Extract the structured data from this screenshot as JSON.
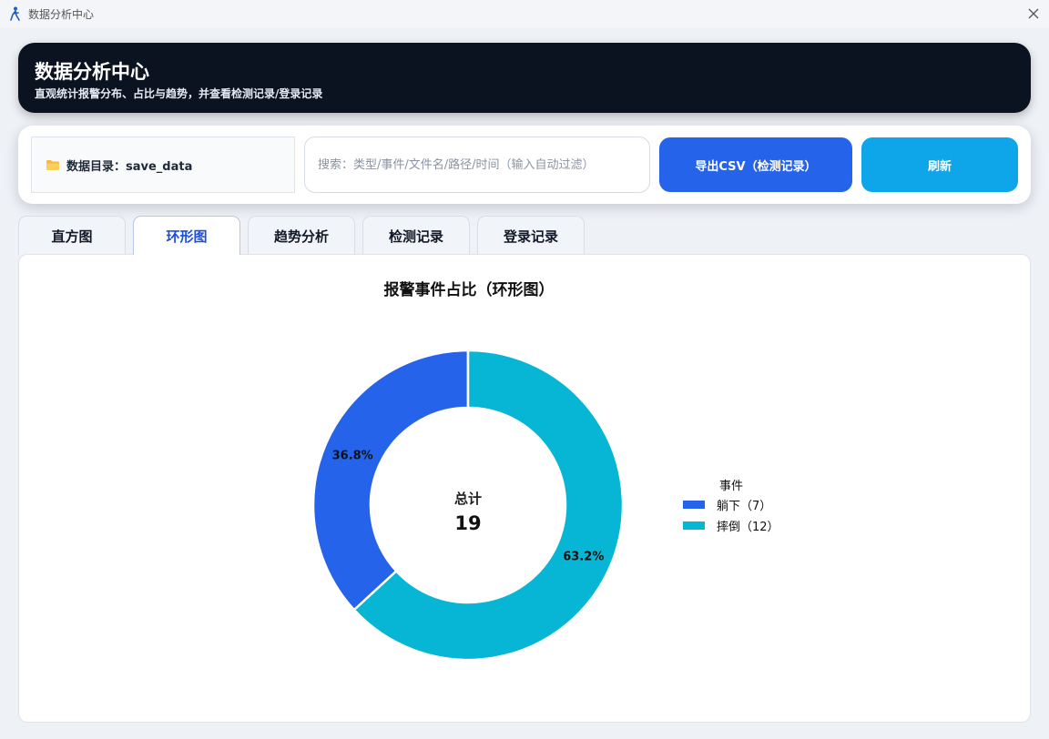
{
  "window": {
    "title": "数据分析中心"
  },
  "header": {
    "title": "数据分析中心",
    "subtitle": "直观统计报警分布、占比与趋势，并查看检测记录/登录记录"
  },
  "toolbar": {
    "data_dir_label": "数据目录：save_data",
    "search_placeholder": "搜索：类型/事件/文件名/路径/时间（输入自动过滤）",
    "search_value": "",
    "export_label": "导出CSV（检测记录）",
    "refresh_label": "刷新"
  },
  "tabs": [
    {
      "label": "直方图",
      "active": false
    },
    {
      "label": "环形图",
      "active": true
    },
    {
      "label": "趋势分析",
      "active": false
    },
    {
      "label": "检测记录",
      "active": false
    },
    {
      "label": "登录记录",
      "active": false
    }
  ],
  "chart_data": {
    "type": "pie",
    "variant": "donut",
    "title": "报警事件占比（环形图）",
    "center_label": "总计",
    "total": 19,
    "categories": [
      "躺下",
      "摔倒"
    ],
    "values": [
      7,
      12
    ],
    "percent_labels": [
      "36.8%",
      "63.2%"
    ],
    "colors": [
      "#2563eb",
      "#06b6d4"
    ],
    "legend_title": "事件",
    "legend_labels": [
      "躺下（7）",
      "摔倒（12）"
    ],
    "legend_position": "right"
  },
  "icons": {
    "app": "app-figure-icon",
    "close": "close-icon",
    "folder": "folder-icon"
  }
}
